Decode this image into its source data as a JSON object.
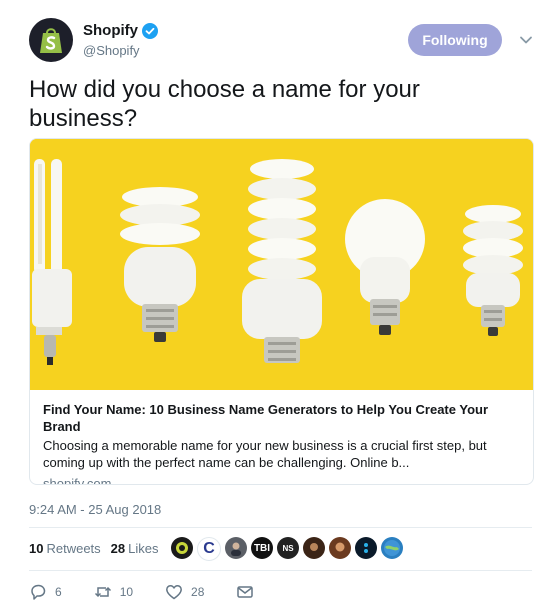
{
  "header": {
    "display_name": "Shopify",
    "handle": "@Shopify",
    "follow_label": "Following"
  },
  "tweet": {
    "text": "How did you choose a name for your business?"
  },
  "card": {
    "title": "Find Your Name: 10 Business Name Generators to Help You Create Your Brand",
    "description": "Choosing a memorable name for your new business is a crucial first step, but coming up with the perfect name can be challenging. Online b...",
    "domain": "shopify.com",
    "image_background": "#f6d21f"
  },
  "meta": {
    "timestamp": "9:24 AM - 25 Aug 2018",
    "retweets_count": "10",
    "retweets_label": "Retweets",
    "likes_count": "28",
    "likes_label": "Likes",
    "likers": [
      "user-avatar-1",
      "user-avatar-2",
      "user-avatar-3",
      "user-avatar-4",
      "user-avatar-5",
      "user-avatar-6",
      "user-avatar-7",
      "user-avatar-8",
      "user-avatar-9"
    ]
  },
  "actions": {
    "reply_count": "6",
    "retweet_count": "10",
    "like_count": "28"
  },
  "colors": {
    "follow_button": "#9fa4d9",
    "verified": "#1da1f2",
    "brand_green": "#95bf47",
    "card_yellow": "#f6d21f"
  },
  "icons": [
    "shopify-bag-icon",
    "verified-badge-icon",
    "chevron-down-icon",
    "reply-icon",
    "retweet-icon",
    "like-icon",
    "message-icon"
  ]
}
